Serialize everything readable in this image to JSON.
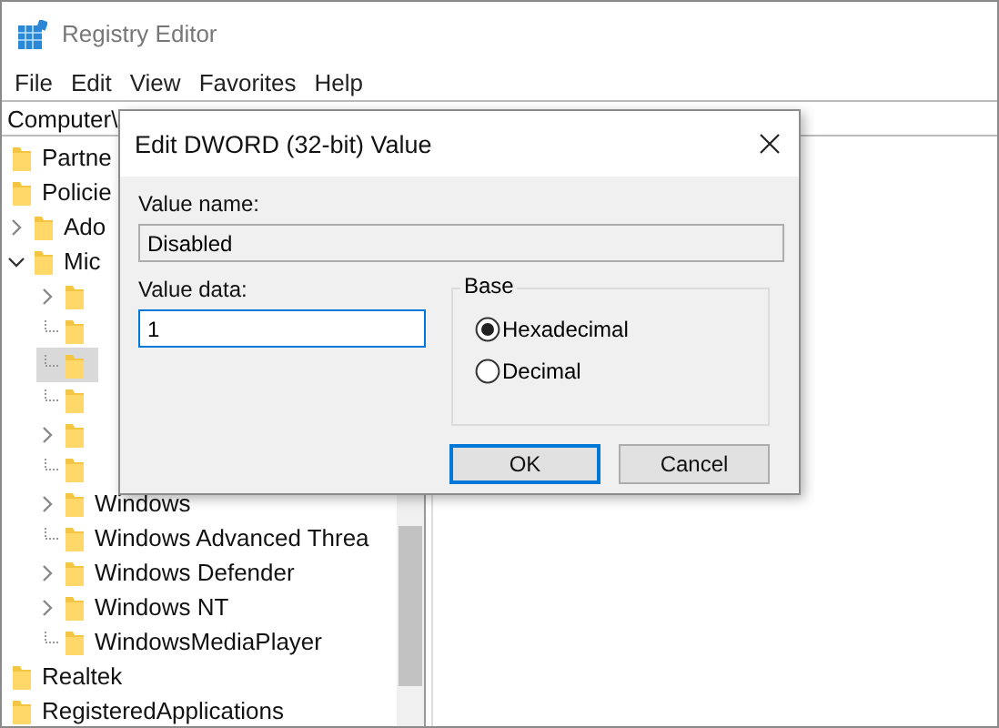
{
  "window": {
    "title": "Registry Editor"
  },
  "menu": [
    "File",
    "Edit",
    "View",
    "Favorites",
    "Help"
  ],
  "address": "Computer\\",
  "tree": [
    {
      "label": "Partne",
      "selected": false
    },
    {
      "label": "Policie",
      "selected": false,
      "children": [
        {
          "label": "Ado",
          "expanded": false,
          "selected": false
        },
        {
          "label": "Mic",
          "expanded": true,
          "selected": false,
          "children": [
            {
              "expanded": false,
              "selected": false
            },
            {
              "selected": false
            },
            {
              "selected": true
            },
            {
              "selected": false
            },
            {
              "expanded": false,
              "selected": false
            },
            {
              "selected": false
            },
            {
              "label": "Windows",
              "expanded": false,
              "selected": false
            },
            {
              "label": "Windows Advanced Threa",
              "selected": false
            },
            {
              "label": "Windows Defender",
              "expanded": false,
              "selected": false
            },
            {
              "label": "Windows NT",
              "expanded": false,
              "selected": false
            },
            {
              "label": "WindowsMediaPlayer",
              "selected": false
            }
          ]
        }
      ]
    },
    {
      "label": "Realtek",
      "selected": false
    },
    {
      "label": "RegisteredApplications",
      "selected": false
    }
  ],
  "dialog": {
    "title": "Edit DWORD (32-bit) Value",
    "value_name_label": "Value name:",
    "value_name": "Disabled",
    "value_data_label": "Value data:",
    "value_data": "1",
    "base_label": "Base",
    "radios": [
      {
        "label": "Hexadecimal",
        "selected": true
      },
      {
        "label": "Decimal",
        "selected": false
      }
    ],
    "buttons": [
      {
        "label": "OK",
        "default": true
      },
      {
        "label": "Cancel",
        "default": false
      }
    ]
  }
}
